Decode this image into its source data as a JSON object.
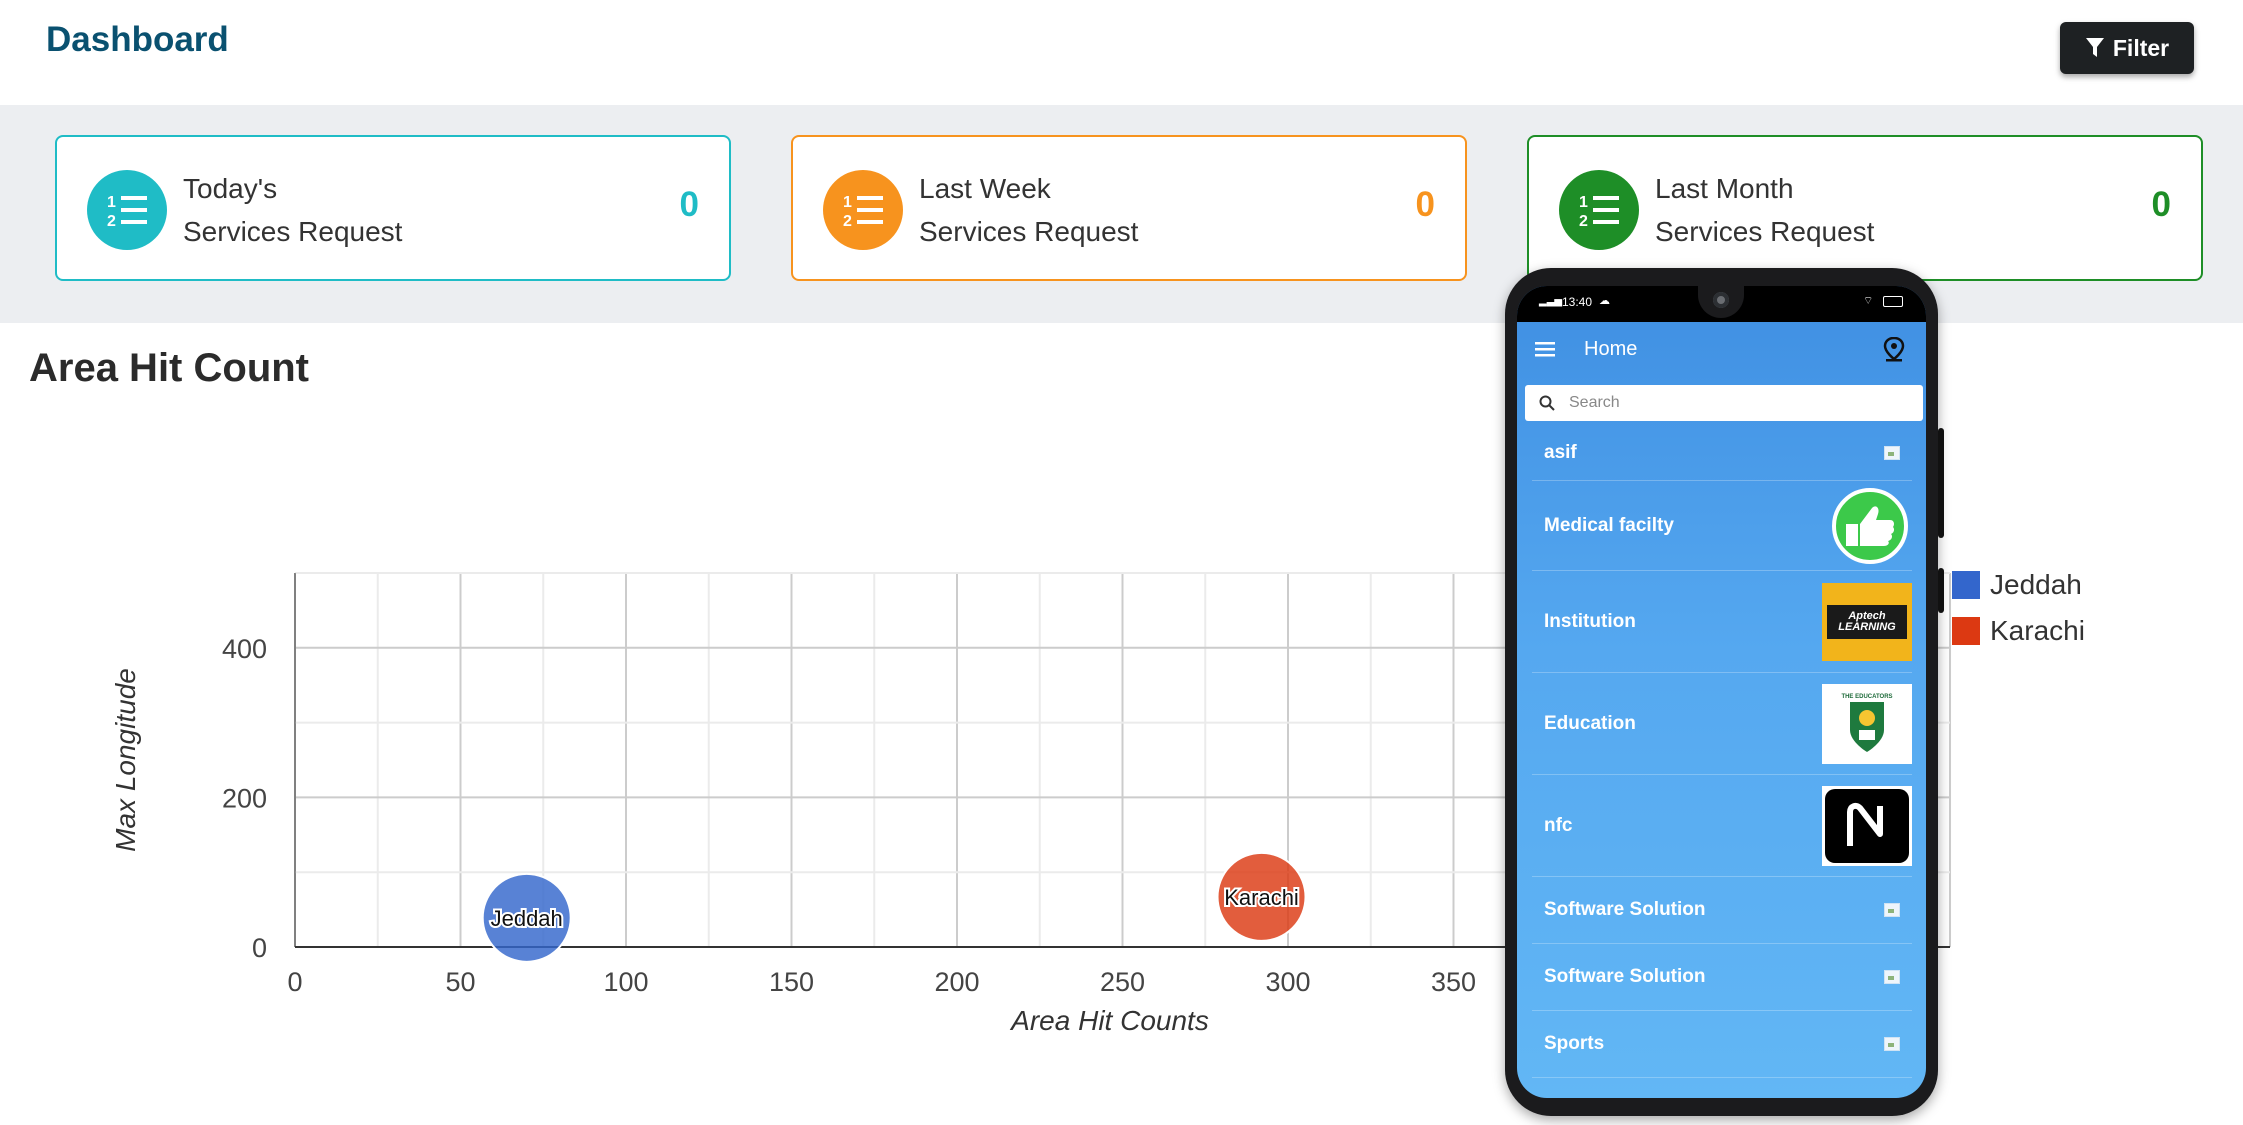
{
  "header": {
    "title": "Dashboard",
    "filter_label": "Filter"
  },
  "cards": [
    {
      "line1": "Today's",
      "line2": "Services Request",
      "value": "0",
      "color": "#1fbcc6"
    },
    {
      "line1": "Last Week",
      "line2": "Services Request",
      "value": "0",
      "color": "#f7931e"
    },
    {
      "line1": "Last Month",
      "line2": "Services Request",
      "value": "0",
      "color": "#1e8e27"
    }
  ],
  "section": {
    "title": "Area Hit Count"
  },
  "chart_data": {
    "type": "scatter",
    "xlabel": "Area Hit Counts",
    "ylabel": "Max Longitude",
    "x_ticks": [
      0,
      50,
      100,
      150,
      200,
      250,
      300,
      350
    ],
    "y_ticks": [
      0,
      200,
      400
    ],
    "xlim": [
      0,
      500
    ],
    "ylim": [
      0,
      500
    ],
    "grid": true,
    "legend_position": "right",
    "series": [
      {
        "name": "Jeddah",
        "x": 70,
        "y": 39,
        "color": "#3366cc"
      },
      {
        "name": "Karachi",
        "x": 292,
        "y": 67,
        "color": "#dc3912"
      }
    ]
  },
  "phone": {
    "status_time": "13:40",
    "app_title": "Home",
    "search_placeholder": "Search",
    "items": [
      {
        "label": "asif",
        "thumb": "broken-image"
      },
      {
        "label": "Medical facilty",
        "thumb": "thumbs-up-logo"
      },
      {
        "label": "Institution",
        "thumb": "aptech-learning-logo",
        "logo_text": "Aptech LEARNING"
      },
      {
        "label": "Education",
        "thumb": "the-educators-logo",
        "logo_text": "THE EDUCATORS"
      },
      {
        "label": "nfc",
        "thumb": "nfc-logo"
      },
      {
        "label": "Software Solution",
        "thumb": "broken-image"
      },
      {
        "label": "Software Solution",
        "thumb": "broken-image"
      },
      {
        "label": "Sports",
        "thumb": "broken-image"
      }
    ]
  }
}
